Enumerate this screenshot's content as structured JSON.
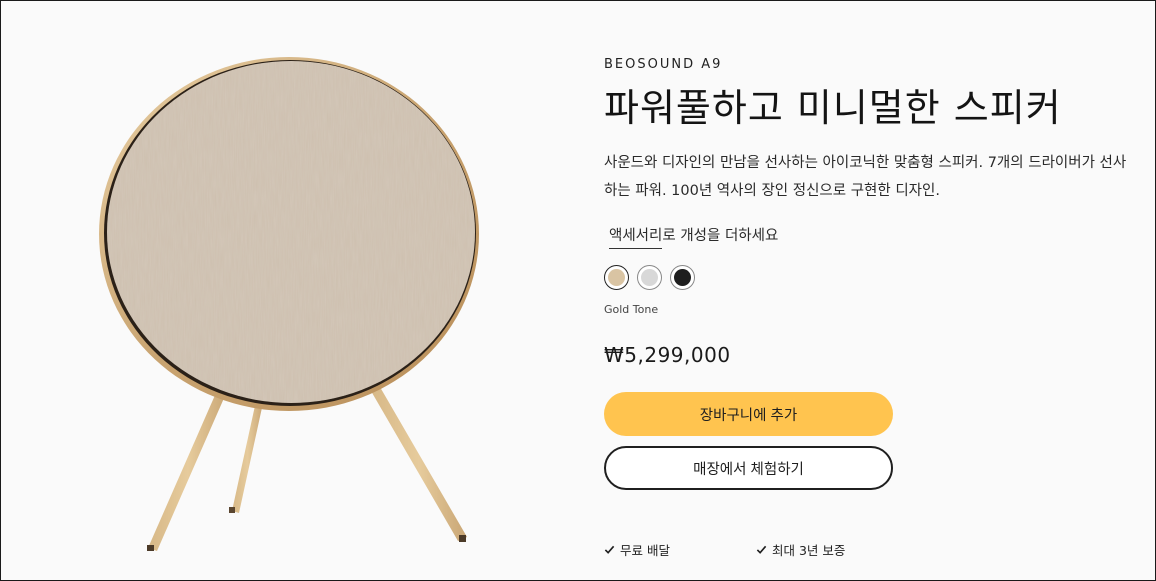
{
  "product": {
    "eyebrow": "BEOSOUND A9",
    "title": "파워풀하고 미니멀한 스피커",
    "description": "사운드와 디자인의 만남을 선사하는 아이코닉한 맞춤형 스피커. 7개의 드라이버가 선사하는 파워. 100년 역사의 장인 정신으로 구현한 디자인.",
    "accessory_link_underlined": "액세서리",
    "accessory_link_rest": "로 개성을 더하세요",
    "colors": [
      {
        "name": "Gold Tone",
        "hex": "#d9c4a3",
        "selected": true
      },
      {
        "name": "Silver",
        "hex": "#d8d8d8",
        "selected": false
      },
      {
        "name": "Black",
        "hex": "#1e1e1e",
        "selected": false
      }
    ],
    "selected_color_label": "Gold Tone",
    "price": "₩5,299,000"
  },
  "actions": {
    "add_to_cart": "장바구니에 추가",
    "try_in_store": "매장에서 체험하기"
  },
  "benefits": [
    {
      "icon": "check-icon",
      "label": "무료 배달"
    },
    {
      "icon": "check-icon",
      "label": "최대 3년 보증"
    }
  ],
  "theme": {
    "accent": "#ffc44f",
    "text": "#1f1f1f",
    "background": "#fafafa"
  }
}
